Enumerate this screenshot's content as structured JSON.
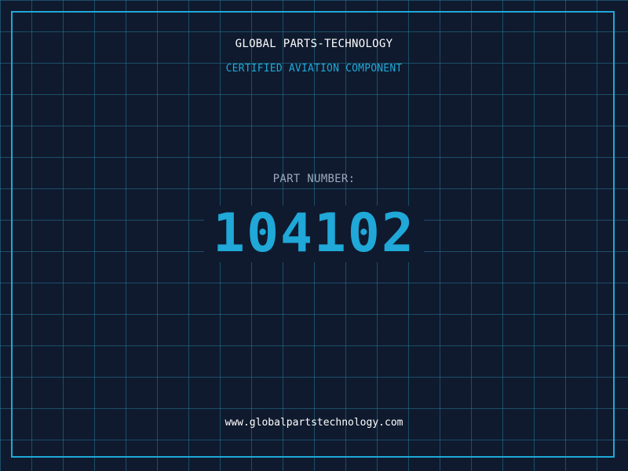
{
  "company": {
    "name": "GLOBAL PARTS-TECHNOLOGY",
    "tagline": "CERTIFIED AVIATION COMPONENT"
  },
  "part": {
    "label": "PART NUMBER:",
    "number": "104102"
  },
  "footer": {
    "website": "www.globalpartstechnology.com"
  },
  "colors": {
    "background": "#0f1a2e",
    "accent": "#1fa8d8",
    "grid": "#267896",
    "title_text": "#ffffff",
    "label_text": "#9aa8bd"
  }
}
